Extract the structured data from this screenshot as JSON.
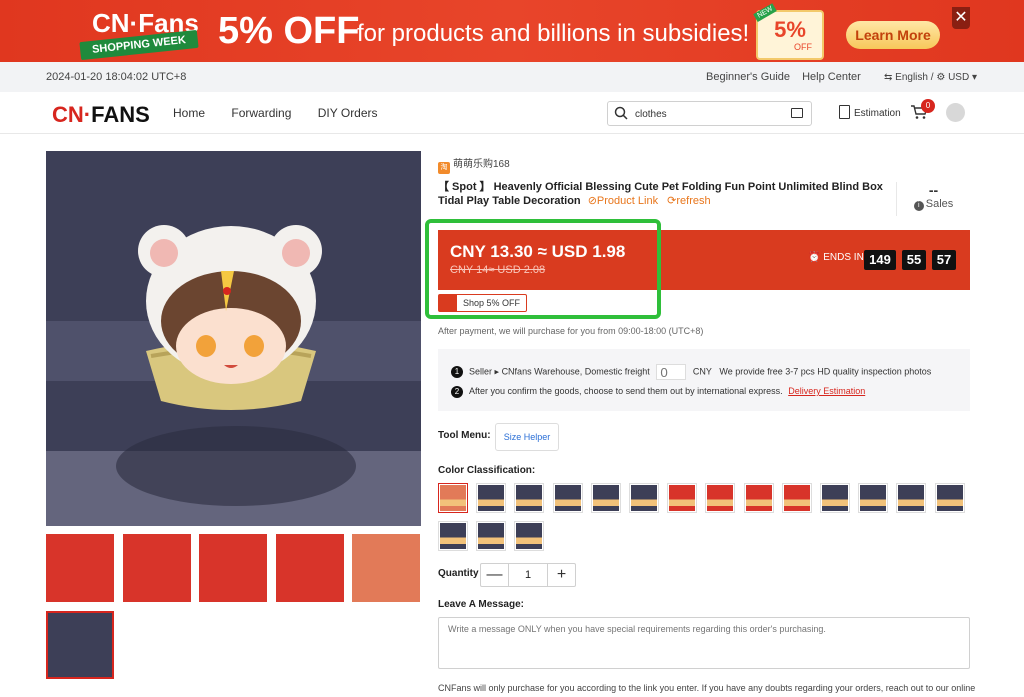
{
  "banner": {
    "brand": "CN·Fans",
    "ribbon": "SHOPPING WEEK",
    "discount": "5% OFF",
    "text": "for products and billions in subsidies!",
    "ticket_pct": "5%",
    "ticket_off": "OFF",
    "ticket_tag": "NEW",
    "learn_more": "Learn More",
    "close": "✕"
  },
  "infobar": {
    "datetime": "2024-01-20 18:04:02 UTC+8",
    "guide": "Beginner's Guide",
    "help": "Help Center",
    "lang": "English / ",
    "currency": "USD"
  },
  "nav": {
    "logo_cn": "CN·",
    "logo_fans": "FANS",
    "links": [
      "Home",
      "Forwarding",
      "DIY Orders"
    ],
    "search_value": "clothes",
    "estimation": "Estimation",
    "cart_count": "0"
  },
  "product": {
    "shop_name": "萌萌乐购168",
    "title": "【 Spot 】 Heavenly Official Blessing Cute Pet Folding Fun Point Unlimited Blind Box Tidal Play Table Decoration",
    "product_link": "Product Link",
    "refresh": "refresh",
    "sales_value": "--",
    "sales_label": "Sales",
    "price": "CNY 13.30 ≈ USD 1.98",
    "old_price": "CNY 14≈ USD 2.08",
    "ends_in": "ENDS IN",
    "countdown": [
      "149",
      "55",
      "57"
    ],
    "shop_discount": "Shop 5% OFF",
    "after_payment": "After payment, we will purchase for you from 09:00-18:00 (UTC+8)"
  },
  "steps": {
    "one": "1",
    "seller": "Seller",
    "warehouse": "CNfans Warehouse, Domestic freight",
    "freight_placeholder": "0",
    "cny": "CNY",
    "photos": "We provide free 3-7 pcs HD quality inspection photos",
    "two": "2",
    "after_confirm": "After you confirm the goods, choose to send them out by international express.",
    "delivery": "Delivery Estimation"
  },
  "options": {
    "tool_menu": "Tool Menu:",
    "size_helper": "Size Helper",
    "color_label": "Color Classification:",
    "quantity_label": "Quantity",
    "quantity_value": "1",
    "minus": "—",
    "plus": "+",
    "message_label": "Leave A Message:",
    "message_placeholder": "Write a message ONLY when you have special requirements regarding this order's purchasing.",
    "footnote": "CNFans will only purchase for you according to the link you enter. If you have any doubts regarding your orders, reach out to our online"
  },
  "colors": {
    "brand_red": "#d7261e",
    "price_red": "#d93b1f",
    "highlight_green": "#2fbf3a"
  }
}
